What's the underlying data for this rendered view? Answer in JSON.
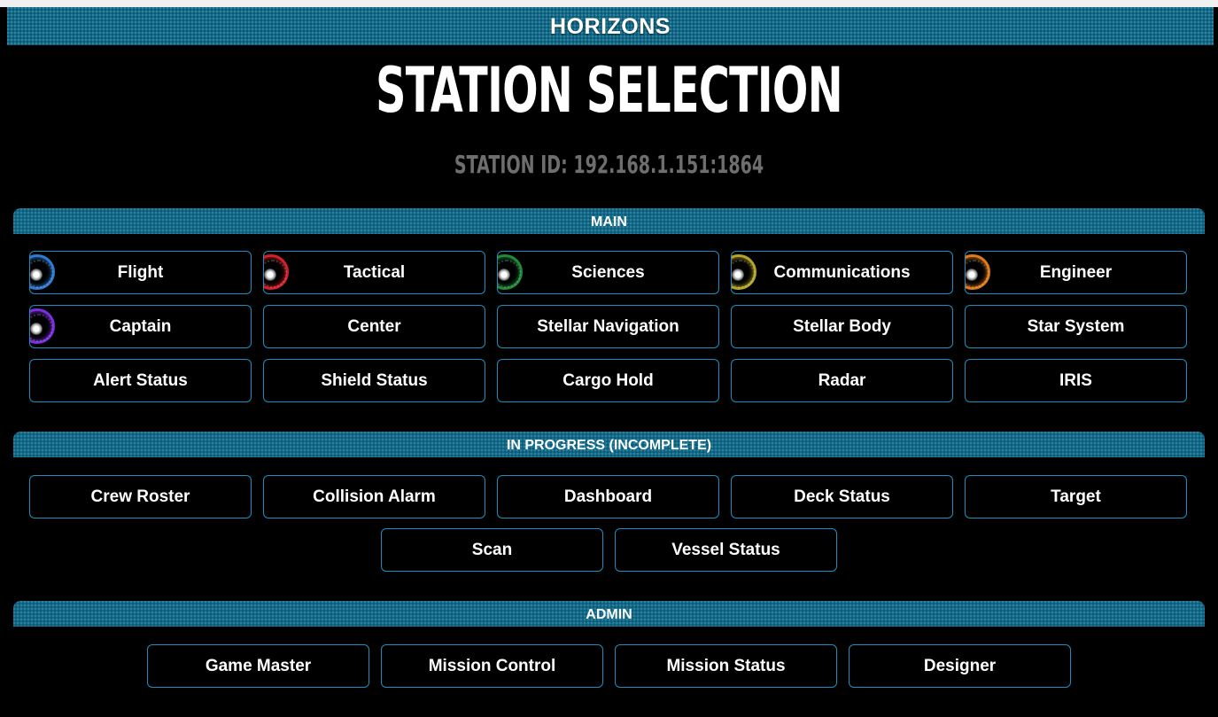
{
  "app": {
    "title": "HORIZONS"
  },
  "page": {
    "title": "STATION SELECTION",
    "station_id": "STATION ID: 192.168.1.151:1864"
  },
  "sections": {
    "main": {
      "label": "MAIN",
      "buttons": [
        {
          "label": "Flight",
          "icon": "flight-icon",
          "icon_color": "#2e7bd6"
        },
        {
          "label": "Tactical",
          "icon": "tactical-icon",
          "icon_color": "#d4202a"
        },
        {
          "label": "Sciences",
          "icon": "sciences-icon",
          "icon_color": "#1f8a3a"
        },
        {
          "label": "Communications",
          "icon": "communications-icon",
          "icon_color": "#b5a62a"
        },
        {
          "label": "Engineer",
          "icon": "engineer-icon",
          "icon_color": "#e07a1a"
        },
        {
          "label": "Captain",
          "icon": "captain-icon",
          "icon_color": "#7a2ee0"
        },
        {
          "label": "Center"
        },
        {
          "label": "Stellar Navigation"
        },
        {
          "label": "Stellar Body"
        },
        {
          "label": "Star System"
        },
        {
          "label": "Alert Status"
        },
        {
          "label": "Shield Status"
        },
        {
          "label": "Cargo Hold"
        },
        {
          "label": "Radar"
        },
        {
          "label": "IRIS"
        }
      ]
    },
    "in_progress": {
      "label": "IN PROGRESS (INCOMPLETE)",
      "buttons": [
        {
          "label": "Crew Roster"
        },
        {
          "label": "Collision Alarm"
        },
        {
          "label": "Dashboard"
        },
        {
          "label": "Deck Status"
        },
        {
          "label": "Target"
        },
        {
          "label": "Scan"
        },
        {
          "label": "Vessel Status"
        }
      ]
    },
    "admin": {
      "label": "ADMIN",
      "buttons": [
        {
          "label": "Game Master"
        },
        {
          "label": "Mission Control"
        },
        {
          "label": "Mission Status"
        },
        {
          "label": "Designer"
        }
      ]
    }
  },
  "colors": {
    "accent_bar": "#0f6a8a",
    "button_border": "#1c8fc0",
    "background": "#000000",
    "station_id_text": "#6e6e6e"
  }
}
